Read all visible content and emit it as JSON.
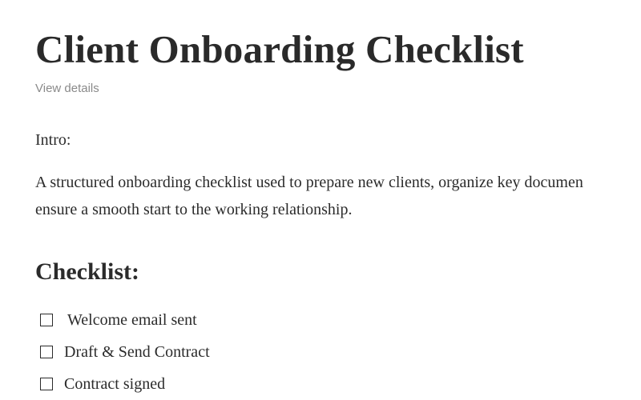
{
  "document": {
    "title": "Client Onboarding Checklist",
    "view_details_label": "View details",
    "intro_label": "Intro:",
    "intro_lines": [
      "A structured onboarding checklist used to prepare new clients, organize key documen",
      "ensure a smooth start to the working relationship."
    ],
    "checklist_heading": "Checklist:",
    "checklist_items": [
      {
        "label": "Welcome email sent",
        "checked": false
      },
      {
        "label": "Draft & Send Contract",
        "checked": false
      },
      {
        "label": "Contract signed",
        "checked": false
      }
    ]
  }
}
